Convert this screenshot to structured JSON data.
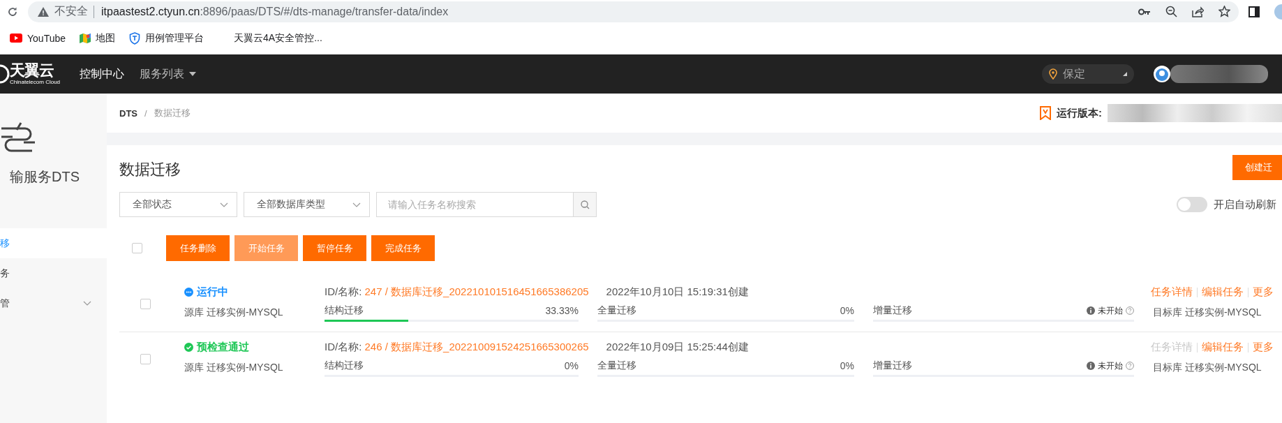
{
  "browser": {
    "security": "不安全",
    "url_host": "itpaastest2.ctyun.cn",
    "url_path": ":8896/paas/DTS/#/dts-manage/transfer-data/index",
    "bookmarks": [
      {
        "label": "YouTube",
        "kind": "video"
      },
      {
        "label": "地图",
        "kind": "map"
      },
      {
        "label": "用例管理平台",
        "kind": "shield"
      },
      {
        "label": "天翼云4A安全管控...",
        "kind": "none"
      }
    ]
  },
  "header": {
    "logo": "天翼云",
    "logo_sub": "Chinatelecom Cloud",
    "nav": [
      {
        "label": "控制中心",
        "selected": true,
        "dropdown": false
      },
      {
        "label": "服务列表",
        "selected": false,
        "dropdown": true
      }
    ],
    "region": "保定"
  },
  "sidebar": {
    "title": "输服务DTS",
    "items": [
      {
        "label": "移",
        "selected": true,
        "expandable": false
      },
      {
        "label": "务",
        "selected": false,
        "expandable": false
      },
      {
        "label": "管",
        "selected": false,
        "expandable": true
      }
    ]
  },
  "breadcrumb": [
    "DTS",
    "/",
    "数据迁移"
  ],
  "version_label": "运行版本:",
  "page_title": "数据迁移",
  "create_button": "创建迁",
  "filters": {
    "status": "全部状态",
    "db_type": "全部数据库类型",
    "search_placeholder": "请输入任务名称搜索"
  },
  "auto_refresh": {
    "label": "开启自动刷新",
    "on": false
  },
  "select_all": {
    "checked": false
  },
  "actions": [
    {
      "label": "任务删除",
      "disabled": false
    },
    {
      "label": "开始任务",
      "disabled": true
    },
    {
      "label": "暂停任务",
      "disabled": false
    },
    {
      "label": "完成任务",
      "disabled": false
    }
  ],
  "tasks": [
    {
      "checked": false,
      "status": "运行中",
      "kind": "running",
      "id_label": "ID/名称:",
      "id_value": "247 / 数据库迁移_202210101516451665386205",
      "created": "2022年10月10日 15:19:31创建",
      "source": "源库 迁移实例-MYSQL",
      "target": "目标库 迁移实例-MYSQL",
      "stages": [
        {
          "kind": "progress",
          "name": "结构迁移",
          "reading": "33.33%",
          "level": 0.33
        },
        {
          "kind": "progress",
          "name": "全量迁移",
          "reading": "0%",
          "level": 0
        },
        {
          "kind": "pending",
          "name": "增量迁移",
          "reading": "未开始"
        }
      ],
      "links": [
        {
          "label": "任务详情",
          "disabled": false
        },
        {
          "label": "编辑任务",
          "disabled": false
        },
        {
          "label": "更多",
          "disabled": false
        }
      ]
    },
    {
      "checked": false,
      "status": "预检查通过",
      "kind": "passed",
      "id_label": "ID/名称:",
      "id_value": "246 / 数据库迁移_202210091524251665300265",
      "created": "2022年10月09日 15:25:44创建",
      "source": "源库 迁移实例-MYSQL",
      "target": "目标库 迁移实例-MYSQL",
      "stages": [
        {
          "kind": "progress",
          "name": "结构迁移",
          "reading": "0%",
          "level": 0
        },
        {
          "kind": "progress",
          "name": "全量迁移",
          "reading": "0%",
          "level": 0
        },
        {
          "kind": "pending",
          "name": "增量迁移",
          "reading": "未开始"
        }
      ],
      "links": [
        {
          "label": "任务详情",
          "disabled": true
        },
        {
          "label": "编辑任务",
          "disabled": false
        },
        {
          "label": "更多",
          "disabled": false
        }
      ]
    }
  ]
}
